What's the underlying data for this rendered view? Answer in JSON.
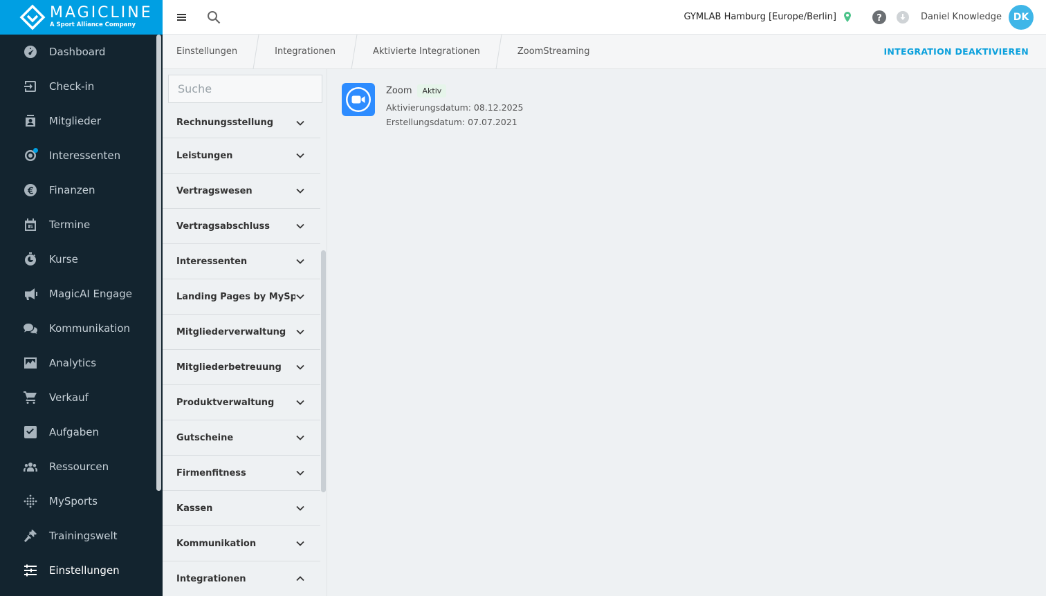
{
  "brand": {
    "name": "MAGICLINE",
    "tagline": "A Sport Alliance Company",
    "color": "#009fe3"
  },
  "sidebar": {
    "items": [
      {
        "label": "Dashboard",
        "icon": "dashboard-icon"
      },
      {
        "label": "Check-in",
        "icon": "check-in-icon"
      },
      {
        "label": "Mitglieder",
        "icon": "members-icon"
      },
      {
        "label": "Interessenten",
        "icon": "leads-icon"
      },
      {
        "label": "Finanzen",
        "icon": "euro-icon"
      },
      {
        "label": "Termine",
        "icon": "calendar-icon"
      },
      {
        "label": "Kurse",
        "icon": "stopwatch-icon"
      },
      {
        "label": "MagicAI Engage",
        "icon": "megaphone-icon"
      },
      {
        "label": "Kommunikation",
        "icon": "chat-icon"
      },
      {
        "label": "Analytics",
        "icon": "chart-icon"
      },
      {
        "label": "Verkauf",
        "icon": "cart-icon"
      },
      {
        "label": "Aufgaben",
        "icon": "checkbox-icon"
      },
      {
        "label": "Ressourcen",
        "icon": "group-icon"
      },
      {
        "label": "MySports",
        "icon": "dots-icon"
      },
      {
        "label": "Trainingswelt",
        "icon": "dumbbell-icon"
      },
      {
        "label": "Einstellungen",
        "icon": "sliders-icon"
      }
    ],
    "active": "Einstellungen"
  },
  "topbar": {
    "studio": "GYMLAB Hamburg [Europe/Berlin]",
    "user_name": "Daniel Knowledge",
    "user_initials": "DK"
  },
  "breadcrumb": [
    "Einstellungen",
    "Integrationen",
    "Aktivierte Integrationen",
    "ZoomStreaming"
  ],
  "actions": {
    "deactivate_label": "INTEGRATION DEAKTIVIEREN"
  },
  "settings_panel": {
    "search_placeholder": "Suche",
    "categories": [
      {
        "label": "Rechnungsstellung",
        "expanded": false
      },
      {
        "label": "Leistungen",
        "expanded": false
      },
      {
        "label": "Vertragswesen",
        "expanded": false
      },
      {
        "label": "Vertragsabschluss",
        "expanded": false
      },
      {
        "label": "Interessenten",
        "expanded": false
      },
      {
        "label": "Landing Pages by MySports",
        "expanded": false
      },
      {
        "label": "Mitgliederverwaltung",
        "expanded": false
      },
      {
        "label": "Mitgliederbetreuung",
        "expanded": false
      },
      {
        "label": "Produktverwaltung",
        "expanded": false
      },
      {
        "label": "Gutscheine",
        "expanded": false
      },
      {
        "label": "Firmenfitness",
        "expanded": false
      },
      {
        "label": "Kassen",
        "expanded": false
      },
      {
        "label": "Kommunikation",
        "expanded": false
      },
      {
        "label": "Integrationen",
        "expanded": true
      }
    ]
  },
  "integration": {
    "name": "Zoom",
    "status": "Aktiv",
    "activation_date": "Aktivierungsdatum: 08.12.2025",
    "creation_date": "Erstellungsdatum: 07.07.2021",
    "logo_color": "#2d8cff"
  }
}
